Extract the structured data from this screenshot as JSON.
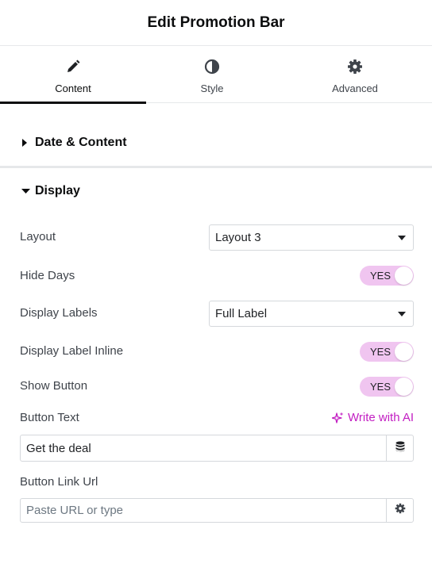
{
  "header": {
    "title": "Edit Promotion Bar"
  },
  "tabs": [
    {
      "label": "Content",
      "icon": "pencil-icon",
      "active": true
    },
    {
      "label": "Style",
      "icon": "half-circle-icon",
      "active": false
    },
    {
      "label": "Advanced",
      "icon": "gear-icon",
      "active": false
    }
  ],
  "sections": {
    "date_content": {
      "title": "Date & Content",
      "expanded": false
    },
    "display": {
      "title": "Display",
      "expanded": true
    }
  },
  "fields": {
    "layout": {
      "label": "Layout",
      "value": "Layout 3"
    },
    "hide_days": {
      "label": "Hide Days",
      "toggle": "YES"
    },
    "display_labels": {
      "label": "Display Labels",
      "value": "Full Label"
    },
    "display_label_inline": {
      "label": "Display Label Inline",
      "toggle": "YES"
    },
    "show_button": {
      "label": "Show Button",
      "toggle": "YES"
    },
    "button_text": {
      "label": "Button Text",
      "value": "Get the deal",
      "ai_label": "Write with AI"
    },
    "button_link_url": {
      "label": "Button Link Url",
      "placeholder": "Paste URL or type"
    }
  },
  "colors": {
    "accent": "#c21ec2",
    "toggle_bg": "#f0c5f0",
    "border": "#d5d8dc"
  }
}
